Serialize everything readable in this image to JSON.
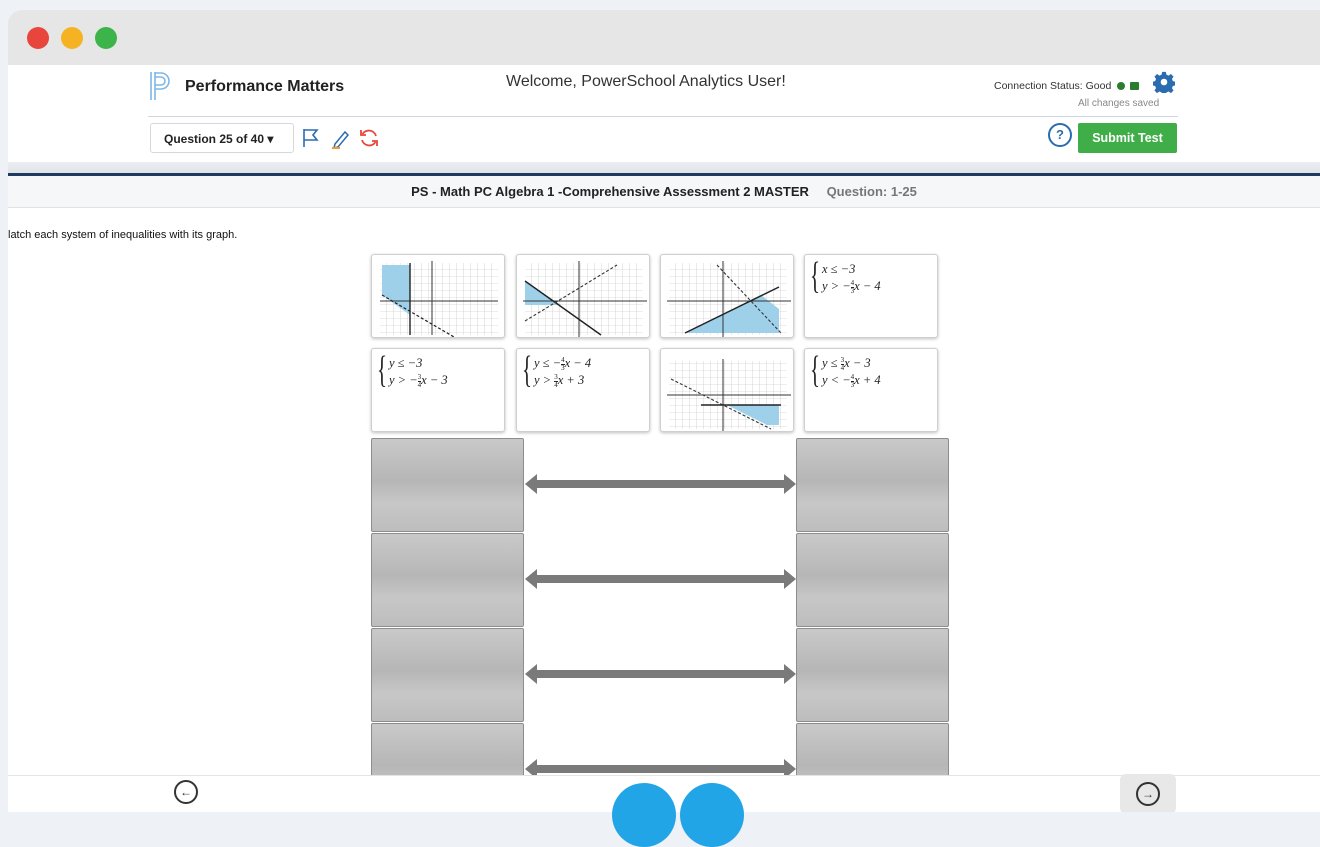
{
  "window": {
    "controls": [
      "close",
      "minimize",
      "maximize"
    ]
  },
  "header": {
    "brand": "Performance Matters",
    "welcome": "Welcome, PowerSchool Analytics User!",
    "connection_status": "Connection Status: Good",
    "saved_status": "All changes saved"
  },
  "toolbar": {
    "question_selector": "Question 25 of 40 ▾",
    "help_label": "?",
    "submit_label": "Submit Test"
  },
  "test": {
    "title": "PS - Math PC Algebra 1 -Comprehensive Assessment 2 MASTER",
    "question_label": "Question: 1-25",
    "prompt": "latch each system of inequalities with its graph."
  },
  "cards": {
    "c4": {
      "l1": "x ≤ −3",
      "l2a": "y > −",
      "l2n": "4",
      "l2d": "3",
      "l2b": "x − 4"
    },
    "c5": {
      "l1": "y ≤ −3",
      "l2a": "y > −",
      "l2n": "3",
      "l2d": "4",
      "l2b": "x − 3"
    },
    "c6": {
      "l1a": "y ≤ −",
      "l1n": "4",
      "l1d": "3",
      "l1b": "x − 4",
      "l2a": "y > ",
      "l2n": "3",
      "l2d": "4",
      "l2b": "x + 3"
    },
    "c8": {
      "l1a": "y ≤ ",
      "l1n": "3",
      "l1d": "4",
      "l1b": "x − 3",
      "l2a": "y < −",
      "l2n": "4",
      "l2d": "3",
      "l2b": "x + 4"
    }
  },
  "icons": {
    "flag": "flag-icon",
    "pencil": "pencil-icon",
    "reset": "reset-icon",
    "settings": "gear-icon",
    "prev": "arrow-left-icon",
    "next": "arrow-right-icon"
  },
  "colors": {
    "accent": "#3fae49",
    "brand": "#1f3a5f",
    "link": "#2b6cb0",
    "shade": "#9fd0ea"
  }
}
